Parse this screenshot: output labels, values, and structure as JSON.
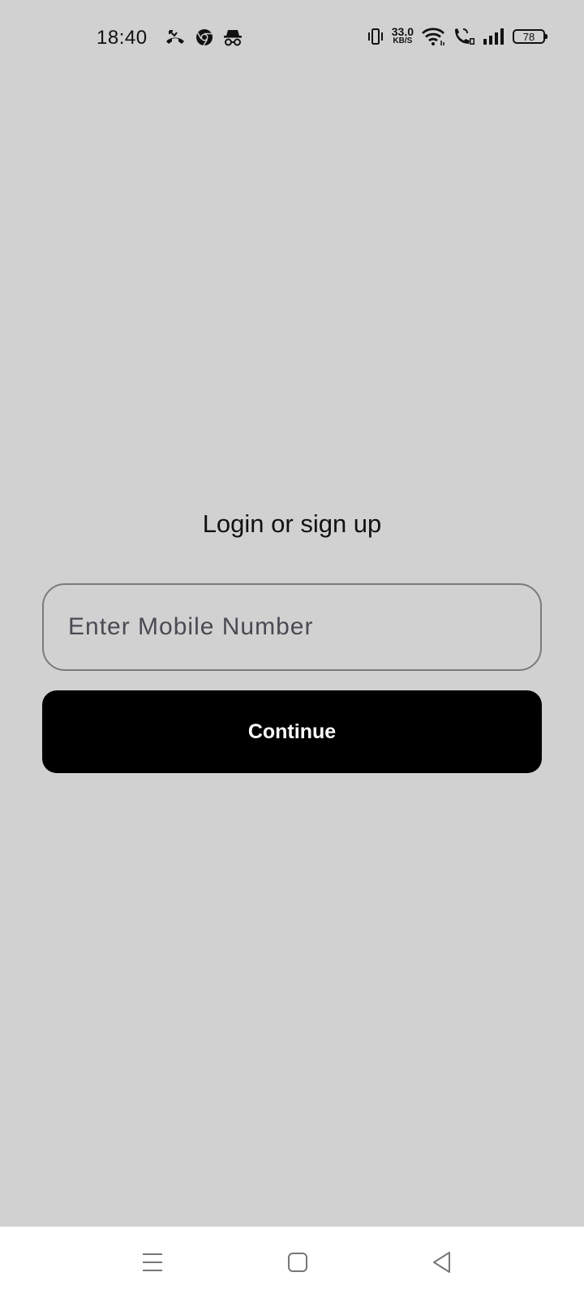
{
  "status_bar": {
    "time": "18:40",
    "net_speed_value": "33.0",
    "net_speed_unit": "KB/S",
    "battery_level": "78",
    "left_icons": [
      "missed-call-icon",
      "chrome-icon",
      "incognito-icon"
    ],
    "right_icons": [
      "vibrate-icon",
      "wifi-icon",
      "wifi-calling-icon",
      "signal-icon",
      "battery-icon"
    ]
  },
  "login": {
    "title": "Login or sign up",
    "mobile_placeholder": "Enter Mobile Number",
    "mobile_value": "",
    "continue_label": "Continue"
  },
  "nav_bar": {
    "buttons": [
      "menu-icon",
      "home-icon",
      "back-icon"
    ]
  },
  "colors": {
    "background": "#d1d1d1",
    "button_bg": "#000000",
    "button_text": "#ffffff",
    "input_border": "#7b7b7f",
    "nav_bg": "#ffffff"
  }
}
